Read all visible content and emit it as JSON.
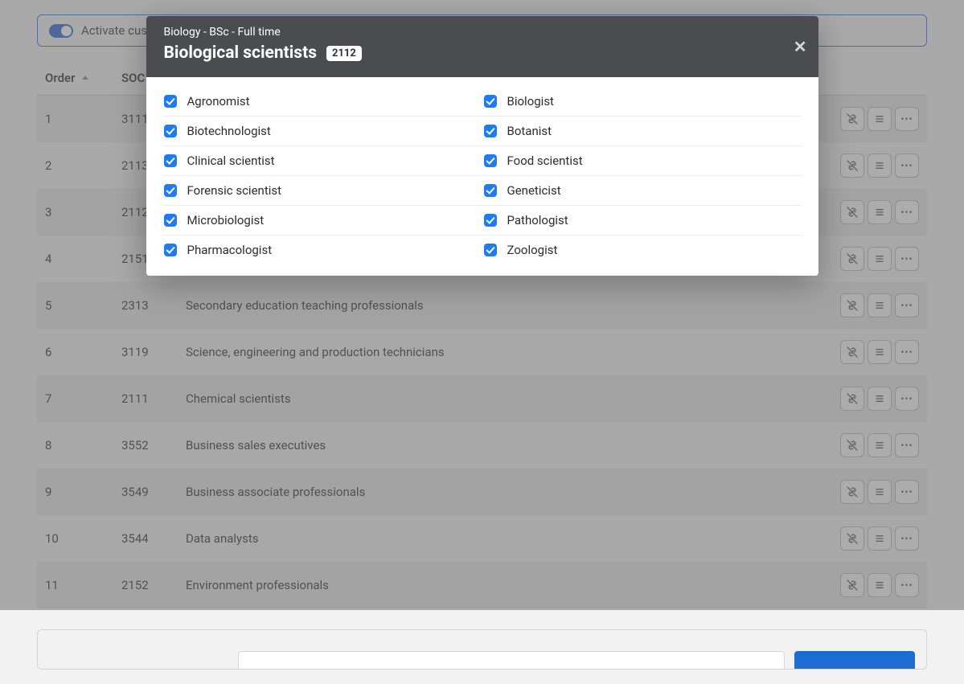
{
  "activate": {
    "label": "Activate cust"
  },
  "table": {
    "headers": {
      "order": "Order",
      "soc": "SOC"
    },
    "rows": [
      {
        "order": "1",
        "soc": "3111",
        "title": ""
      },
      {
        "order": "2",
        "soc": "2113",
        "title": ""
      },
      {
        "order": "3",
        "soc": "2112",
        "title": ""
      },
      {
        "order": "4",
        "soc": "2151",
        "title": ""
      },
      {
        "order": "5",
        "soc": "2313",
        "title": "Secondary education teaching professionals"
      },
      {
        "order": "6",
        "soc": "3119",
        "title": "Science, engineering and production technicians"
      },
      {
        "order": "7",
        "soc": "2111",
        "title": "Chemical scientists"
      },
      {
        "order": "8",
        "soc": "3552",
        "title": "Business sales executives"
      },
      {
        "order": "9",
        "soc": "3549",
        "title": "Business associate professionals"
      },
      {
        "order": "10",
        "soc": "3544",
        "title": "Data analysts"
      },
      {
        "order": "11",
        "soc": "2152",
        "title": "Environment professionals"
      }
    ]
  },
  "modal": {
    "subheading": "Biology - BSc - Full time",
    "title": "Biological scientists",
    "code": "2112",
    "items": [
      [
        "Agronomist",
        "Biologist"
      ],
      [
        "Biotechnologist",
        "Botanist"
      ],
      [
        "Clinical scientist",
        "Food scientist"
      ],
      [
        "Forensic scientist",
        "Geneticist"
      ],
      [
        "Microbiologist",
        "Pathologist"
      ],
      [
        "Pharmacologist",
        "Zoologist"
      ]
    ]
  }
}
